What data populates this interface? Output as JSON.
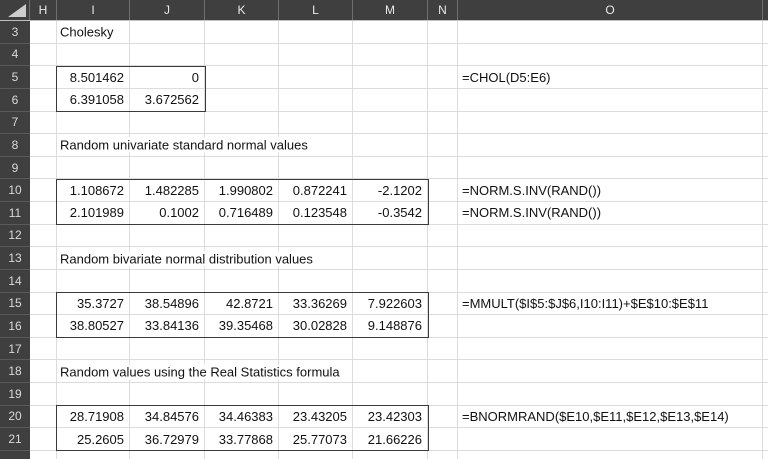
{
  "sheet": {
    "columns": [
      "H",
      "I",
      "J",
      "K",
      "L",
      "M",
      "N",
      "O"
    ],
    "rows": [
      {
        "n": "3",
        "label": "Cholesky"
      },
      {
        "n": "4"
      },
      {
        "n": "5",
        "values": [
          "8.501462",
          "0"
        ],
        "formula": "=CHOL(D5:E6)"
      },
      {
        "n": "6",
        "values": [
          "6.391058",
          "3.672562"
        ]
      },
      {
        "n": "7"
      },
      {
        "n": "8",
        "label": "Random univariate standard normal values"
      },
      {
        "n": "9"
      },
      {
        "n": "10",
        "values": [
          "1.108672",
          "1.482285",
          "1.990802",
          "0.872241",
          "-2.1202"
        ],
        "formula": "=NORM.S.INV(RAND())"
      },
      {
        "n": "11",
        "values": [
          "2.101989",
          "0.1002",
          "0.716489",
          "0.123548",
          "-0.3542"
        ],
        "formula": "=NORM.S.INV(RAND())"
      },
      {
        "n": "12"
      },
      {
        "n": "13",
        "label": "Random bivariate normal distribution values"
      },
      {
        "n": "14"
      },
      {
        "n": "15",
        "values": [
          "35.3727",
          "38.54896",
          "42.8721",
          "33.36269",
          "7.922603"
        ],
        "formula": "=MMULT($I$5:$J$6,I10:I11)+$E$10:$E$11"
      },
      {
        "n": "16",
        "values": [
          "38.80527",
          "33.84136",
          "39.35468",
          "30.02828",
          "9.148876"
        ]
      },
      {
        "n": "17"
      },
      {
        "n": "18",
        "label": "Random values using the Real Statistics formula"
      },
      {
        "n": "19"
      },
      {
        "n": "20",
        "values": [
          "28.71908",
          "34.84576",
          "34.46383",
          "23.43205",
          "23.42303"
        ],
        "formula": "=BNORMRAND($E10,$E11,$E12,$E13,$E14)"
      },
      {
        "n": "21",
        "values": [
          "25.2605",
          "36.72979",
          "33.77868",
          "25.77073",
          "21.66226"
        ]
      }
    ],
    "ranges": {
      "cholesky_matrix": "I5:J6",
      "univariate_values": "I10:M11",
      "bivariate_values": "I15:M16",
      "real_statistics_values": "I20:M21"
    }
  },
  "colors": {
    "header_bg": "#3f3f3f",
    "header_text": "#e9e9e9",
    "header_divider": "#6e6e6e",
    "gridline": "#dcdcdc",
    "range_border": "#3a3a3a",
    "cell_text": "#111111",
    "row_header_text": "#d9d9d9",
    "select_all_triangle": "#cdcdcd"
  }
}
